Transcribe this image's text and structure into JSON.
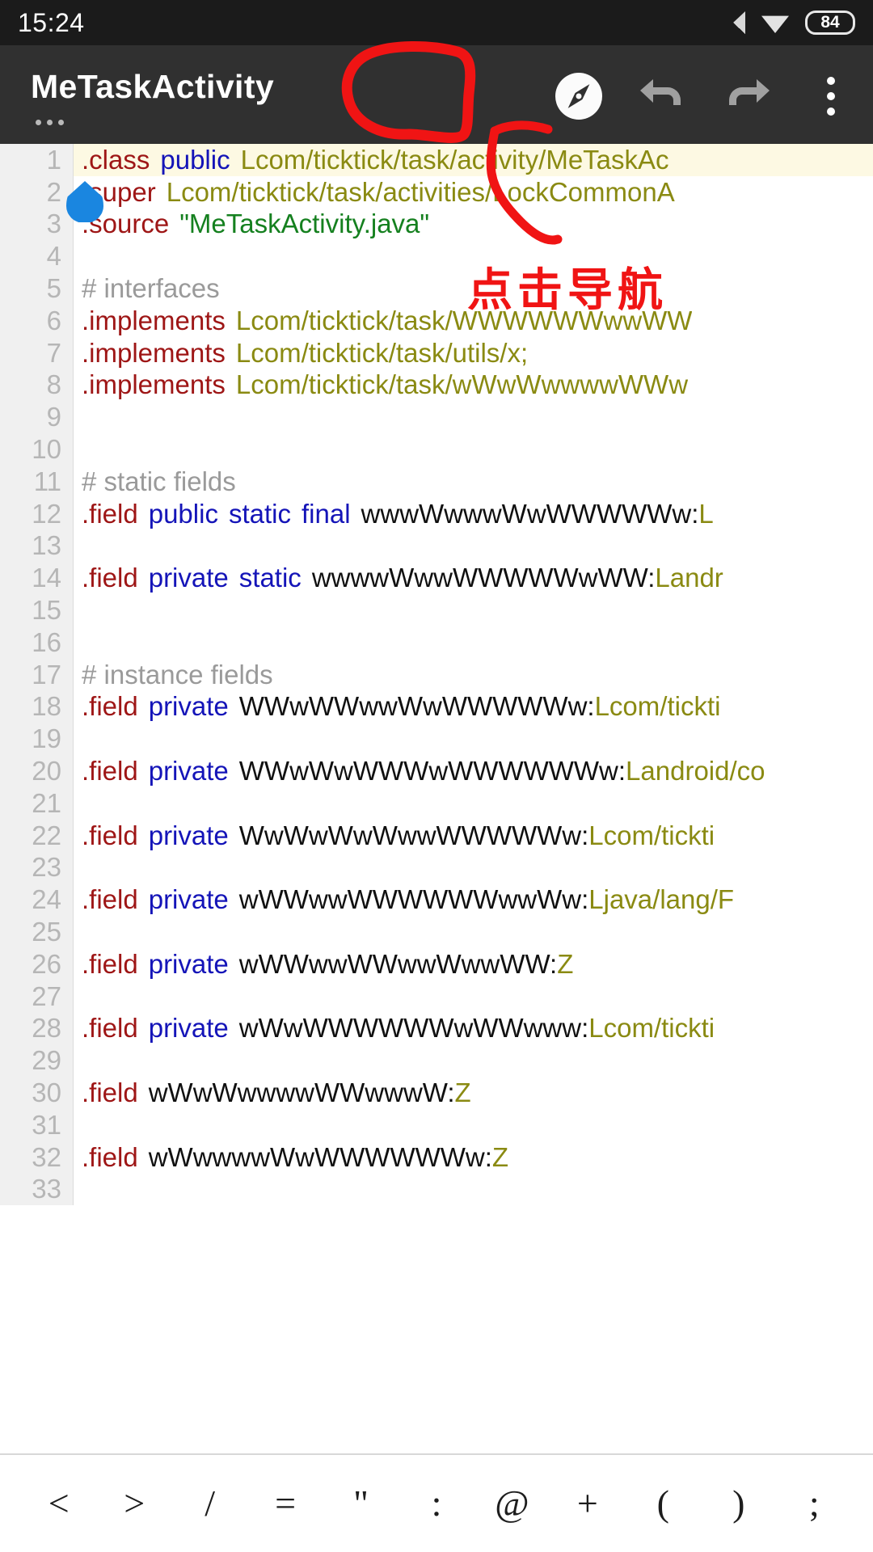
{
  "status_bar": {
    "clock": "15:24",
    "battery_level": "84",
    "signal_icon": "cellular-signal-icon",
    "wifi_icon": "wifi-icon",
    "battery_icon": "battery-icon"
  },
  "app_bar": {
    "title": "MeTaskActivity",
    "subtitle_dots": "...",
    "actions": [
      {
        "name": "navigate-compass-button",
        "icon": "compass-icon",
        "label": ""
      },
      {
        "name": "undo-button",
        "icon": "undo-arrow-icon",
        "label": ""
      },
      {
        "name": "redo-button",
        "icon": "redo-arrow-icon",
        "label": ""
      },
      {
        "name": "overflow-menu-button",
        "icon": "kebab-menu-icon",
        "label": ""
      }
    ]
  },
  "annotation": {
    "text": "点击导航",
    "color": "#f01414",
    "circle_target": "navigate-compass-button"
  },
  "editor": {
    "accent_highlight": "#fdf9e3",
    "gutter_bg": "#f0f0f0",
    "colors": {
      "directive": "#9e1616",
      "keyword": "#1414b8",
      "type": "#8a8a12",
      "string": "#15801f",
      "comment": "#9a9a9a",
      "plain": "#101010",
      "line_number": "#b6b6b6"
    },
    "lines": [
      {
        "n": "1",
        "hl": true,
        "tokens": [
          {
            "c": "dir",
            "t": ".class"
          },
          {
            "c": "sp"
          },
          {
            "c": "kw",
            "t": "public"
          },
          {
            "c": "sp"
          },
          {
            "c": "type",
            "t": "Lcom/ticktick/task/activity/MeTaskAc"
          }
        ]
      },
      {
        "n": "2",
        "hl": false,
        "tokens": [
          {
            "c": "dir",
            "t": ".super"
          },
          {
            "c": "sp"
          },
          {
            "c": "type",
            "t": "Lcom/ticktick/task/activities/LockCommonA"
          }
        ]
      },
      {
        "n": "3",
        "hl": false,
        "tokens": [
          {
            "c": "dir",
            "t": ".source"
          },
          {
            "c": "sp"
          },
          {
            "c": "str",
            "t": "\"MeTaskActivity.java\""
          }
        ]
      },
      {
        "n": "4",
        "hl": false,
        "tokens": []
      },
      {
        "n": "5",
        "hl": false,
        "tokens": [
          {
            "c": "cmt",
            "t": "# interfaces"
          }
        ]
      },
      {
        "n": "6",
        "hl": false,
        "tokens": [
          {
            "c": "dir",
            "t": ".implements"
          },
          {
            "c": "sp"
          },
          {
            "c": "type",
            "t": "Lcom/ticktick/task/WWWWWWwwWW"
          }
        ]
      },
      {
        "n": "7",
        "hl": false,
        "tokens": [
          {
            "c": "dir",
            "t": ".implements"
          },
          {
            "c": "sp"
          },
          {
            "c": "type",
            "t": "Lcom/ticktick/task/utils/x;"
          }
        ]
      },
      {
        "n": "8",
        "hl": false,
        "tokens": [
          {
            "c": "dir",
            "t": ".implements"
          },
          {
            "c": "sp"
          },
          {
            "c": "type",
            "t": "Lcom/ticktick/task/wWwWwwwwWWw"
          }
        ]
      },
      {
        "n": "9",
        "hl": false,
        "tokens": []
      },
      {
        "n": "10",
        "hl": false,
        "tokens": []
      },
      {
        "n": "11",
        "hl": false,
        "tokens": [
          {
            "c": "cmt",
            "t": "# static fields"
          }
        ]
      },
      {
        "n": "12",
        "hl": false,
        "tokens": [
          {
            "c": "dir",
            "t": ".field"
          },
          {
            "c": "sp"
          },
          {
            "c": "kw",
            "t": "public"
          },
          {
            "c": "sp"
          },
          {
            "c": "kw",
            "t": "static"
          },
          {
            "c": "sp"
          },
          {
            "c": "kw",
            "t": "final"
          },
          {
            "c": "sp"
          },
          {
            "c": "plain",
            "t": "wwwWwwwWwWWWWWw:"
          },
          {
            "c": "type",
            "t": "L"
          }
        ]
      },
      {
        "n": "13",
        "hl": false,
        "tokens": []
      },
      {
        "n": "14",
        "hl": false,
        "tokens": [
          {
            "c": "dir",
            "t": ".field"
          },
          {
            "c": "sp"
          },
          {
            "c": "kw",
            "t": "private"
          },
          {
            "c": "sp"
          },
          {
            "c": "kw",
            "t": "static"
          },
          {
            "c": "sp"
          },
          {
            "c": "plain",
            "t": "wwwwWwwWWWWWwWW:"
          },
          {
            "c": "type",
            "t": "Landr"
          }
        ]
      },
      {
        "n": "15",
        "hl": false,
        "tokens": []
      },
      {
        "n": "16",
        "hl": false,
        "tokens": []
      },
      {
        "n": "17",
        "hl": false,
        "tokens": [
          {
            "c": "cmt",
            "t": "# instance fields"
          }
        ]
      },
      {
        "n": "18",
        "hl": false,
        "tokens": [
          {
            "c": "dir",
            "t": ".field"
          },
          {
            "c": "sp"
          },
          {
            "c": "kw",
            "t": "private"
          },
          {
            "c": "sp"
          },
          {
            "c": "plain",
            "t": "WWwWWwwWwWWWWWw:"
          },
          {
            "c": "type",
            "t": "Lcom/tickti"
          }
        ]
      },
      {
        "n": "19",
        "hl": false,
        "tokens": []
      },
      {
        "n": "20",
        "hl": false,
        "tokens": [
          {
            "c": "dir",
            "t": ".field"
          },
          {
            "c": "sp"
          },
          {
            "c": "kw",
            "t": "private"
          },
          {
            "c": "sp"
          },
          {
            "c": "plain",
            "t": "WWwWwWWWwWWWWWWw:"
          },
          {
            "c": "type",
            "t": "Landroid/co"
          }
        ]
      },
      {
        "n": "21",
        "hl": false,
        "tokens": []
      },
      {
        "n": "22",
        "hl": false,
        "tokens": [
          {
            "c": "dir",
            "t": ".field"
          },
          {
            "c": "sp"
          },
          {
            "c": "kw",
            "t": "private"
          },
          {
            "c": "sp"
          },
          {
            "c": "plain",
            "t": "WwWwWwWwwWWWWWw:"
          },
          {
            "c": "type",
            "t": "Lcom/tickti"
          }
        ]
      },
      {
        "n": "23",
        "hl": false,
        "tokens": []
      },
      {
        "n": "24",
        "hl": false,
        "tokens": [
          {
            "c": "dir",
            "t": ".field"
          },
          {
            "c": "sp"
          },
          {
            "c": "kw",
            "t": "private"
          },
          {
            "c": "sp"
          },
          {
            "c": "plain",
            "t": "wWWwwWWWWWWwwWw:"
          },
          {
            "c": "type",
            "t": "Ljava/lang/F"
          }
        ]
      },
      {
        "n": "25",
        "hl": false,
        "tokens": []
      },
      {
        "n": "26",
        "hl": false,
        "tokens": [
          {
            "c": "dir",
            "t": ".field"
          },
          {
            "c": "sp"
          },
          {
            "c": "kw",
            "t": "private"
          },
          {
            "c": "sp"
          },
          {
            "c": "plain",
            "t": "wWWwwWWwwWwwWW:"
          },
          {
            "c": "type",
            "t": "Z"
          }
        ]
      },
      {
        "n": "27",
        "hl": false,
        "tokens": []
      },
      {
        "n": "28",
        "hl": false,
        "tokens": [
          {
            "c": "dir",
            "t": ".field"
          },
          {
            "c": "sp"
          },
          {
            "c": "kw",
            "t": "private"
          },
          {
            "c": "sp"
          },
          {
            "c": "plain",
            "t": "wWwWWWWWWwWWwww:"
          },
          {
            "c": "type",
            "t": "Lcom/tickti"
          }
        ]
      },
      {
        "n": "29",
        "hl": false,
        "tokens": []
      },
      {
        "n": "30",
        "hl": false,
        "tokens": [
          {
            "c": "dir",
            "t": ".field"
          },
          {
            "c": "sp"
          },
          {
            "c": "plain",
            "t": "wWwWwwwwWWwwwW:"
          },
          {
            "c": "type",
            "t": "Z"
          }
        ]
      },
      {
        "n": "31",
        "hl": false,
        "tokens": []
      },
      {
        "n": "32",
        "hl": false,
        "tokens": [
          {
            "c": "dir",
            "t": ".field"
          },
          {
            "c": "sp"
          },
          {
            "c": "plain",
            "t": "wWwwwwWwWWWWWWw:"
          },
          {
            "c": "type",
            "t": "Z"
          }
        ]
      },
      {
        "n": "33",
        "hl": false,
        "tokens": []
      }
    ]
  },
  "symbol_bar": {
    "symbols": [
      "<",
      ">",
      "/",
      "=",
      "\"",
      ":",
      "@",
      "+",
      "(",
      ")",
      ";"
    ]
  }
}
